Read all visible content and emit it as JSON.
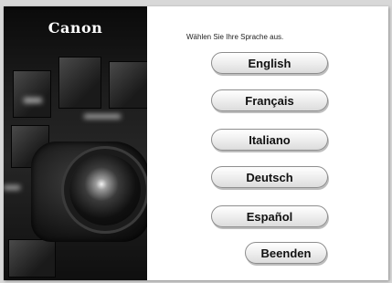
{
  "brand": {
    "logo_text": "Canon"
  },
  "prompt": "Wählen Sie Ihre Sprache aus.",
  "languages": [
    {
      "label": "English"
    },
    {
      "label": "Français"
    },
    {
      "label": "Italiano"
    },
    {
      "label": "Deutsch"
    },
    {
      "label": "Español"
    }
  ],
  "exit_label": "Beenden"
}
